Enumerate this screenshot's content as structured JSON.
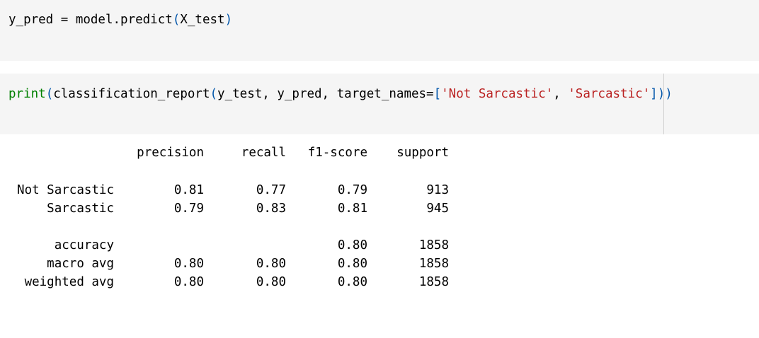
{
  "cells": [
    {
      "tokens": [
        {
          "text": "y_pred = model.predict",
          "cls": "tok-op"
        },
        {
          "text": "(",
          "cls": "tok-paren"
        },
        {
          "text": "X_test",
          "cls": "tok-op"
        },
        {
          "text": ")",
          "cls": "tok-paren"
        }
      ]
    },
    {
      "tokens": [
        {
          "text": "print",
          "cls": "tok-fn"
        },
        {
          "text": "(",
          "cls": "tok-paren"
        },
        {
          "text": "classification_report",
          "cls": "tok-op"
        },
        {
          "text": "(",
          "cls": "tok-paren"
        },
        {
          "text": "y_test, y_pred, target_names=",
          "cls": "tok-op"
        },
        {
          "text": "[",
          "cls": "tok-paren"
        },
        {
          "text": "'Not Sarcastic'",
          "cls": "tok-str"
        },
        {
          "text": ", ",
          "cls": "tok-op"
        },
        {
          "text": "'Sarcastic'",
          "cls": "tok-str"
        },
        {
          "text": "]",
          "cls": "tok-paren"
        },
        {
          "text": "))",
          "cls": "tok-paren"
        }
      ]
    }
  ],
  "report": {
    "header": {
      "label": "",
      "precision": "precision",
      "recall": "recall",
      "f1": "f1-score",
      "support": "support"
    },
    "rows": [
      {
        "label": "Not Sarcastic",
        "precision": "0.81",
        "recall": "0.77",
        "f1": "0.79",
        "support": "913"
      },
      {
        "label": "Sarcastic",
        "precision": "0.79",
        "recall": "0.83",
        "f1": "0.81",
        "support": "945"
      },
      {
        "label": "accuracy",
        "precision": "",
        "recall": "",
        "f1": "0.80",
        "support": "1858"
      },
      {
        "label": "macro avg",
        "precision": "0.80",
        "recall": "0.80",
        "f1": "0.80",
        "support": "1858"
      },
      {
        "label": "weighted avg",
        "precision": "0.80",
        "recall": "0.80",
        "f1": "0.80",
        "support": "1858"
      }
    ]
  },
  "colors": {
    "cell_bg": "#f5f5f5",
    "function": "#008000",
    "bracket": "#0055aa",
    "string": "#ba2121"
  }
}
